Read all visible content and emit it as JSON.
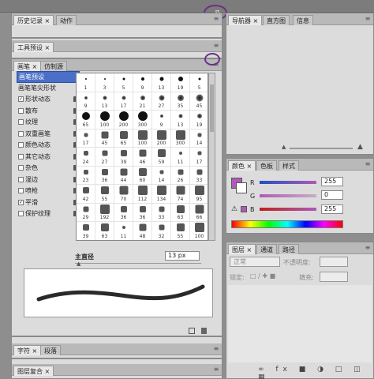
{
  "left_column": {
    "history_panel": {
      "tabs": [
        {
          "label": "历史记录 ×",
          "active": true
        },
        {
          "label": "动作",
          "active": false
        }
      ]
    },
    "tool_presets_panel": {
      "tabs": [
        {
          "label": "工具预设 ×",
          "active": true
        }
      ]
    },
    "brush_panel": {
      "tabs": [
        {
          "label": "画笔 ×",
          "active": true
        },
        {
          "label": "仿制源",
          "active": false
        }
      ],
      "options": [
        {
          "label": "画笔预设",
          "checkbox": false,
          "checked": false,
          "selected": true,
          "lock": false
        },
        {
          "label": "画笔笔尖形状",
          "checkbox": false,
          "checked": false,
          "selected": false,
          "lock": false
        },
        {
          "label": "形状动态",
          "checkbox": true,
          "checked": true,
          "selected": false,
          "lock": true
        },
        {
          "label": "散布",
          "checkbox": true,
          "checked": false,
          "selected": false,
          "lock": true
        },
        {
          "label": "纹理",
          "checkbox": true,
          "checked": false,
          "selected": false,
          "lock": true
        },
        {
          "label": "双重画笔",
          "checkbox": true,
          "checked": false,
          "selected": false,
          "lock": true
        },
        {
          "label": "颜色动态",
          "checkbox": true,
          "checked": false,
          "selected": false,
          "lock": true
        },
        {
          "label": "其它动态",
          "checkbox": true,
          "checked": false,
          "selected": false,
          "lock": true
        },
        {
          "label": "杂色",
          "checkbox": true,
          "checked": false,
          "selected": false,
          "lock": true
        },
        {
          "label": "湿边",
          "checkbox": true,
          "checked": false,
          "selected": false,
          "lock": true
        },
        {
          "label": "喷枪",
          "checkbox": true,
          "checked": false,
          "selected": false,
          "lock": true
        },
        {
          "label": "平滑",
          "checkbox": true,
          "checked": true,
          "selected": false,
          "lock": true
        },
        {
          "label": "保护纹理",
          "checkbox": true,
          "checked": false,
          "selected": false,
          "lock": true
        }
      ],
      "brush_sizes": [
        "1",
        "3",
        "5",
        "9",
        "13",
        "19",
        "5",
        "9",
        "13",
        "17",
        "21",
        "27",
        "35",
        "45",
        "65",
        "100",
        "200",
        "300",
        "9",
        "13",
        "19",
        "17",
        "45",
        "65",
        "100",
        "200",
        "300",
        "14",
        "24",
        "27",
        "39",
        "46",
        "59",
        "11",
        "17",
        "23",
        "36",
        "44",
        "60",
        "14",
        "26",
        "33",
        "42",
        "55",
        "70",
        "112",
        "134",
        "74",
        "95",
        "29",
        "192",
        "36",
        "36",
        "33",
        "63",
        "66",
        "39",
        "63",
        "11",
        "48",
        "32",
        "55",
        "100"
      ],
      "master_diameter_label": "主直径",
      "master_diameter_value": "13 px"
    },
    "character_panel": {
      "tabs": [
        {
          "label": "字符 ×",
          "active": true
        },
        {
          "label": "段落",
          "active": false
        }
      ]
    },
    "layer_comps_panel": {
      "tabs": [
        {
          "label": "图层复合 ×",
          "active": true
        }
      ]
    }
  },
  "right_column": {
    "navigator_panel": {
      "tabs": [
        {
          "label": "导航器 ×",
          "active": true
        },
        {
          "label": "直方图",
          "active": false
        },
        {
          "label": "信息",
          "active": false
        }
      ]
    },
    "color_panel": {
      "tabs": [
        {
          "label": "颜色 ×",
          "active": true
        },
        {
          "label": "色板",
          "active": false
        },
        {
          "label": "样式",
          "active": false
        }
      ],
      "channels": [
        {
          "label": "R",
          "value": "255"
        },
        {
          "label": "G",
          "value": "0"
        },
        {
          "label": "B",
          "value": "255"
        }
      ]
    },
    "layers_panel": {
      "tabs": [
        {
          "label": "图层 ×",
          "active": true
        },
        {
          "label": "通道",
          "active": false
        },
        {
          "label": "路径",
          "active": false
        }
      ],
      "blend_mode": "正常",
      "opacity_label": "不透明度:",
      "lock_label": "锁定:",
      "fill_label": "填充:"
    }
  },
  "colors": {
    "selection": "#4a6fc8",
    "swatch": "#b05ab8",
    "annotation": "#6b2f86"
  }
}
